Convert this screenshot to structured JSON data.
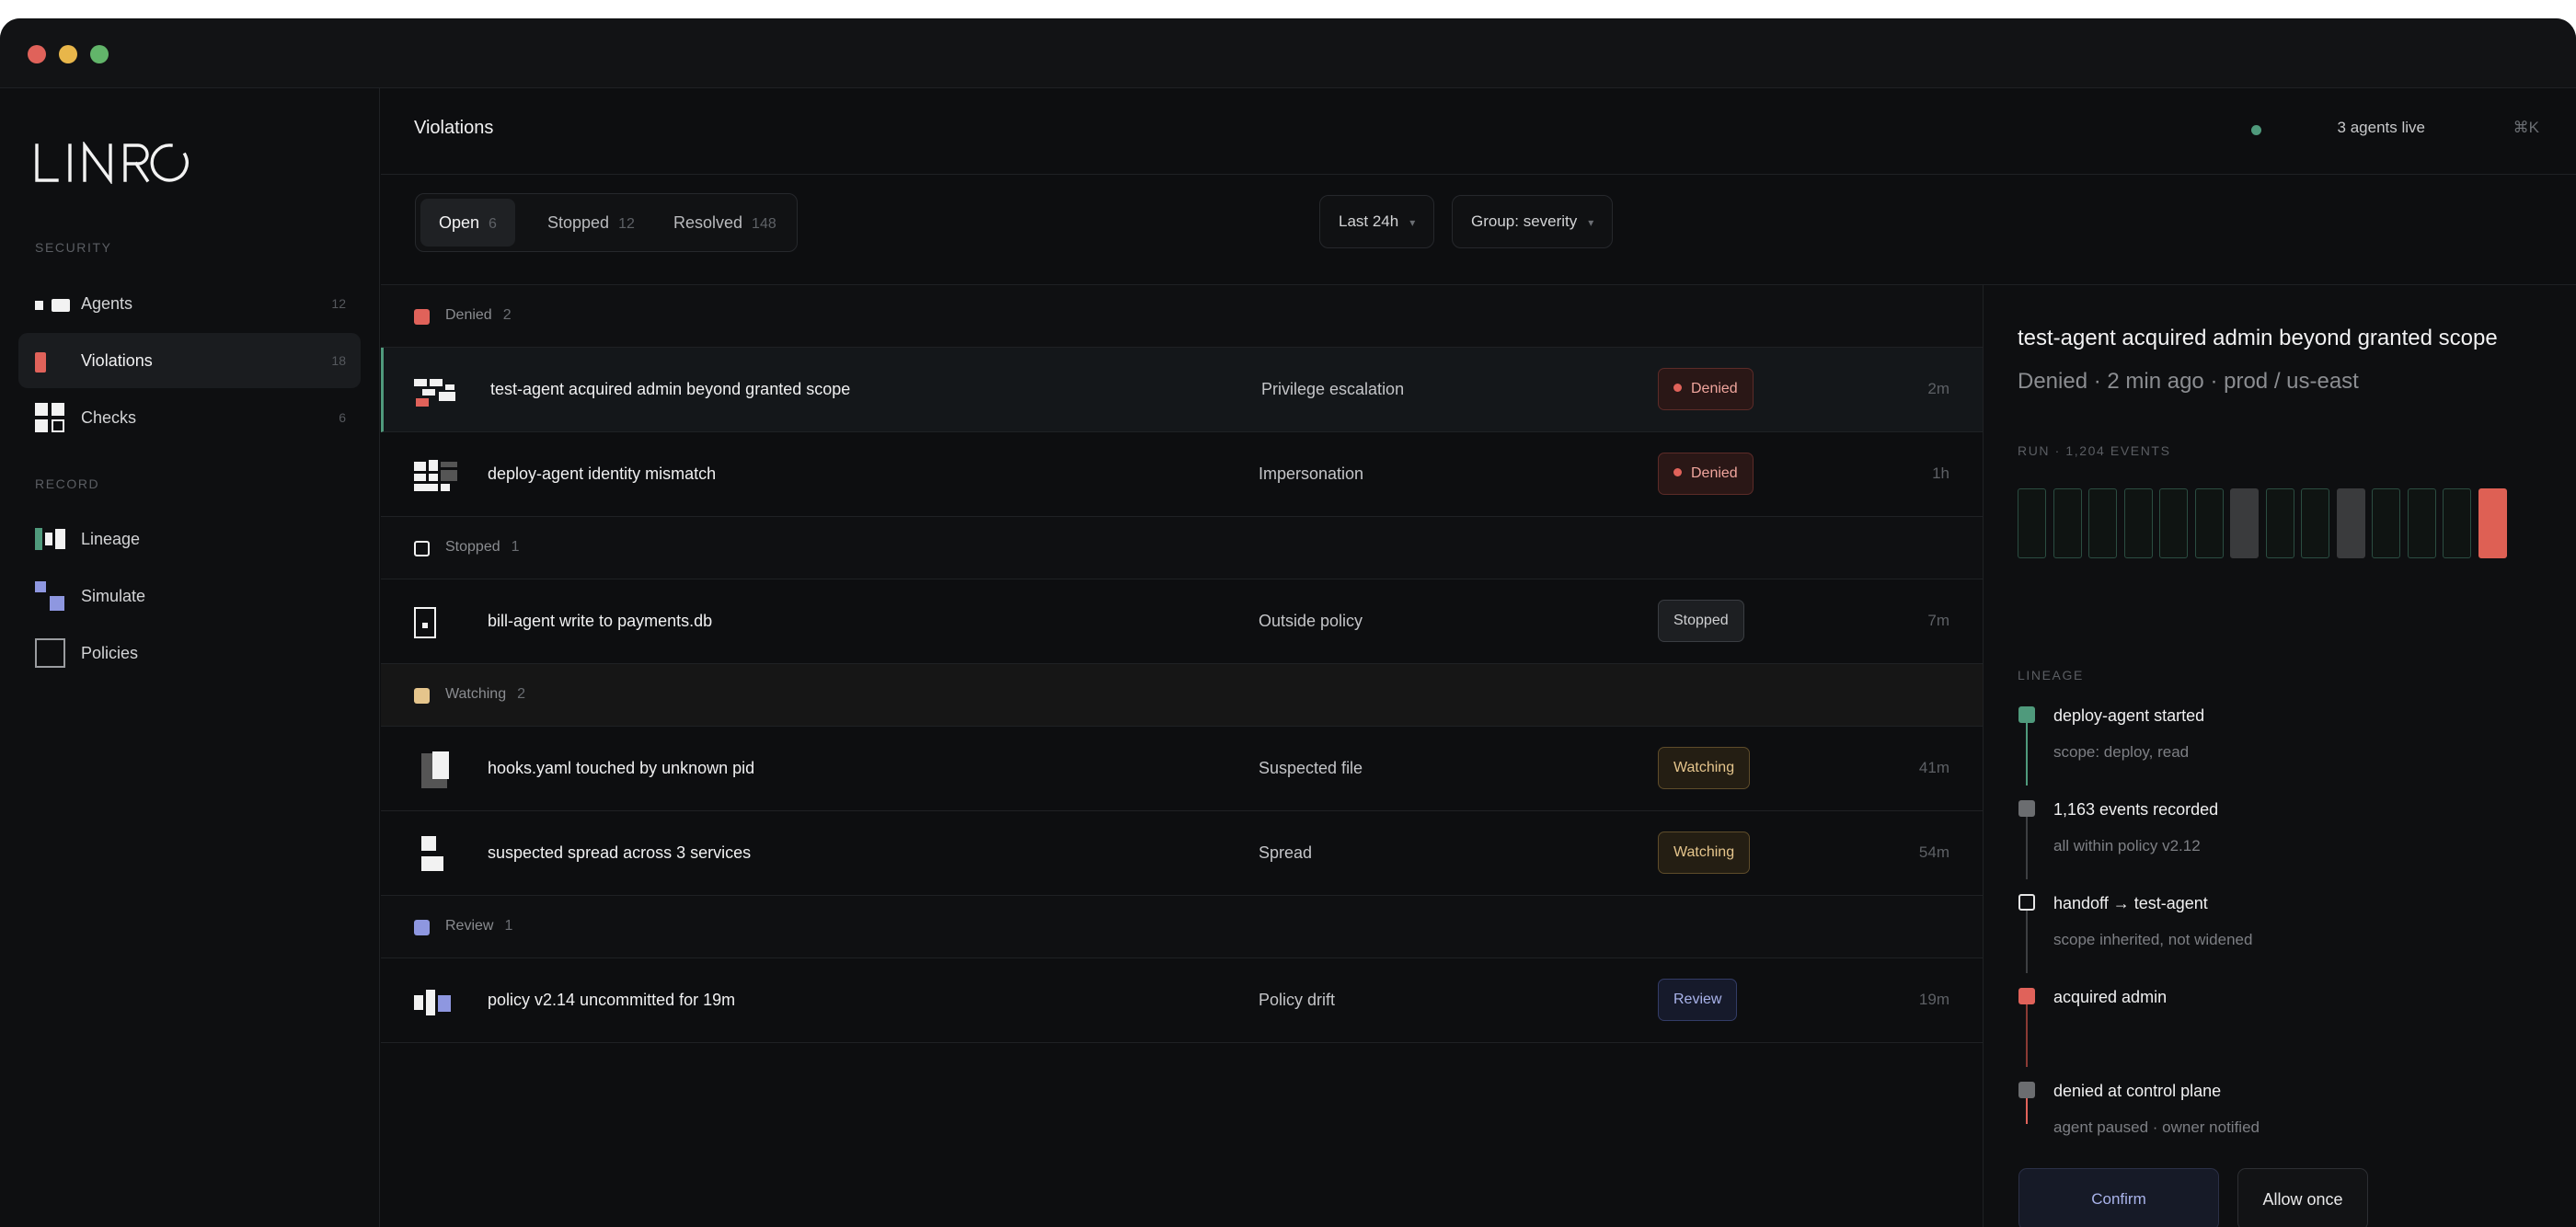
{
  "window": {
    "dot_colors": [
      "#e0625a",
      "#e8b64a",
      "#62b56a"
    ]
  },
  "brand": {
    "name": "LINRO"
  },
  "sidebar": {
    "security_label": "SECURITY",
    "record_label": "RECORD",
    "items": [
      {
        "label": "Agents",
        "count": "12",
        "icon": "agents-icon"
      },
      {
        "label": "Violations",
        "count": "18",
        "icon": "violations-icon",
        "active": true
      },
      {
        "label": "Checks",
        "count": "6",
        "icon": "checks-icon"
      },
      {
        "label": "Lineage",
        "icon": "lineage-icon"
      },
      {
        "label": "Simulate",
        "icon": "simulate-icon"
      },
      {
        "label": "Policies",
        "icon": "policies-icon"
      }
    ]
  },
  "header": {
    "title": "Violations",
    "live_status": "3 agents live",
    "shortcut": "⌘K"
  },
  "tabs": [
    {
      "label": "Open",
      "count": "6",
      "active": true
    },
    {
      "label": "Stopped",
      "count": "12"
    },
    {
      "label": "Resolved",
      "count": "148"
    }
  ],
  "filters": {
    "time": "Last 24h",
    "group": "Group: severity"
  },
  "groups": [
    {
      "label": "Denied",
      "count": "2",
      "color": "#e0625a",
      "rows": [
        {
          "title": "test-agent acquired admin beyond granted scope",
          "type": "Privilege escalation",
          "status": "Denied",
          "time": "2m"
        },
        {
          "title": "deploy-agent identity mismatch",
          "type": "Impersonation",
          "status": "Denied",
          "time": "1h"
        }
      ]
    },
    {
      "label": "Stopped",
      "count": "1",
      "color": "#ffffff",
      "rows": [
        {
          "title": "bill-agent write to payments.db",
          "type": "Outside policy",
          "status": "Stopped",
          "time": "7m"
        }
      ]
    },
    {
      "label": "Watching",
      "count": "2",
      "color": "#e5c58c",
      "rows": [
        {
          "title": "hooks.yaml touched by unknown pid",
          "type": "Suspected file",
          "status": "Watching",
          "time": "41m"
        },
        {
          "title": "suspected spread across 3 services",
          "type": "Spread",
          "status": "Watching",
          "time": "54m"
        }
      ]
    },
    {
      "label": "Review",
      "count": "1",
      "color": "#8e97e0",
      "rows": [
        {
          "title": "policy v2.14 uncommitted for 19m",
          "type": "Policy drift",
          "status": "Review",
          "time": "19m"
        }
      ]
    }
  ],
  "detail": {
    "title": "test-agent acquired admin beyond granted scope",
    "subtitle": "Denied · 2 min ago · prod / us-east",
    "run_label": "RUN · 1,204 EVENTS",
    "run_bars": [
      "normal",
      "normal",
      "normal",
      "normal",
      "normal",
      "normal",
      "grey",
      "normal",
      "normal",
      "grey",
      "normal",
      "normal",
      "normal",
      "red"
    ],
    "lineage_label": "LINEAGE",
    "lineage": [
      {
        "title": "deploy-agent started",
        "sub": "scope: deploy, read",
        "node_color": "#4f9a7c"
      },
      {
        "title": "1,163 events recorded",
        "sub": "all within policy v2.12",
        "node_color": "#6b6d70"
      },
      {
        "title": "handoff → test-agent",
        "sub": "scope inherited, not widened",
        "node_color": "#0e0f11"
      },
      {
        "title": "acquired admin",
        "sub": "",
        "node_color": "#e0625a"
      },
      {
        "title": "denied at control plane",
        "sub": "agent paused · owner notified",
        "node_color": "#6b6d70"
      }
    ],
    "confirm_label": "Confirm",
    "allow_label": "Allow once"
  }
}
